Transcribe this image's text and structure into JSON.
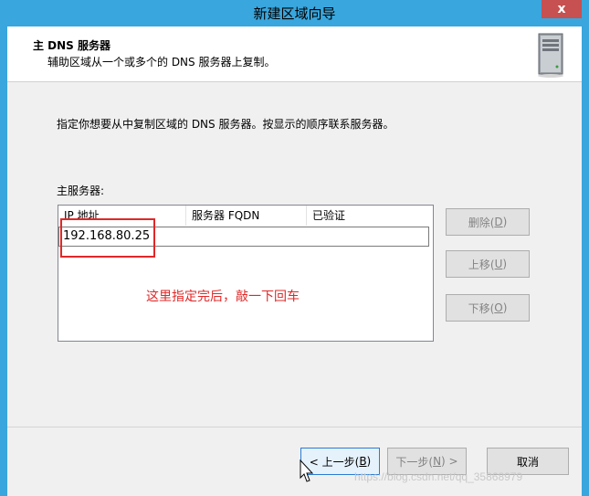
{
  "window": {
    "title": "新建区域向导",
    "close_label": "x"
  },
  "header": {
    "title": "主 DNS 服务器",
    "description": "辅助区域从一个或多个的 DNS 服务器上复制。",
    "icon": "server-icon"
  },
  "instruction": "指定你想要从中复制区域的 DNS 服务器。按显示的顺序联系服务器。",
  "primary_label": "主服务器:",
  "list": {
    "columns": [
      "IP 地址",
      "服务器 FQDN",
      "已验证"
    ],
    "ip_value": "192.168.80.25"
  },
  "annotation": "这里指定完后，敲一下回车",
  "side_buttons": {
    "delete": {
      "label": "删除(",
      "key": "D",
      "suffix": ")"
    },
    "up": {
      "label": "上移(",
      "key": "U",
      "suffix": ")"
    },
    "down": {
      "label": "下移(",
      "key": "O",
      "suffix": ")"
    }
  },
  "nav": {
    "back": {
      "label": "< 上一步(",
      "key": "B",
      "suffix": ")"
    },
    "next": {
      "label": "下一步(",
      "key": "N",
      "suffix": ") >"
    },
    "cancel": "取消"
  },
  "watermark": "https://blog.csdn.net/qq_35868979",
  "colors": {
    "frame": "#39a6dd",
    "close": "#c75050",
    "annotation": "#e02828",
    "focus": "#2b7bd3"
  }
}
